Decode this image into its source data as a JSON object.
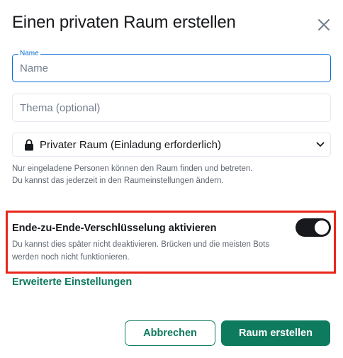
{
  "dialog": {
    "title": "Einen privaten Raum erstellen",
    "close_icon": "close-icon"
  },
  "name_field": {
    "legend": "Name",
    "placeholder": "Name",
    "value": ""
  },
  "topic_field": {
    "placeholder": "Thema (optional)",
    "value": ""
  },
  "join_rule_select": {
    "icon": "lock-icon",
    "selected": "Privater Raum (Einladung erforderlich)",
    "chevron_icon": "chevron-down-icon"
  },
  "join_rule_help": "Nur eingeladene Personen können den Raum finden und betreten. Du kannst das jederzeit in den Raumeinstellungen ändern.",
  "encryption": {
    "label": "Ende-zu-Ende-Verschlüsselung aktivieren",
    "description": "Du kannst dies später nicht deaktivieren. Brücken und die meisten Bots werden noch nicht funktionieren.",
    "enabled": true,
    "highlight_color": "#e8271a"
  },
  "advanced_link": "Erweiterte Einstellungen",
  "buttons": {
    "cancel": "Abbrechen",
    "create": "Raum erstellen"
  },
  "colors": {
    "accent": "#0e7a5e",
    "focus": "#0a6cd1",
    "text": "#17191c",
    "muted": "#5f6670"
  }
}
